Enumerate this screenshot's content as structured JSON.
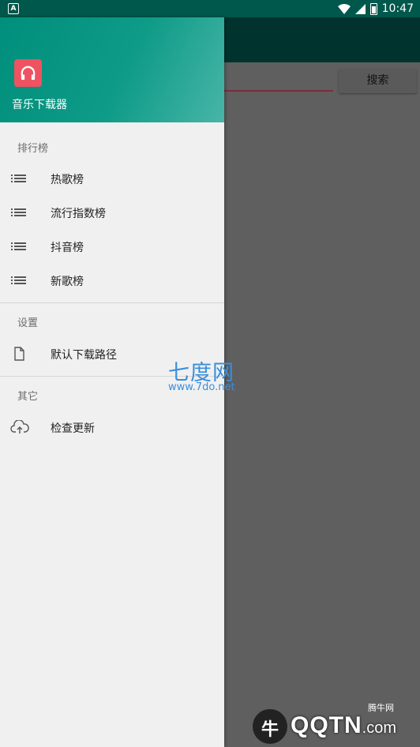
{
  "status_bar": {
    "time": "10:47",
    "notification_icon": "A"
  },
  "background": {
    "search_button": "搜索"
  },
  "drawer": {
    "app_name": "音乐下载器",
    "sections": [
      {
        "title": "排行榜",
        "items": [
          "热歌榜",
          "流行指数榜",
          "抖音榜",
          "新歌榜"
        ]
      },
      {
        "title": "设置",
        "items": [
          "默认下载路径"
        ]
      },
      {
        "title": "其它",
        "items": [
          "检查更新"
        ]
      }
    ]
  },
  "watermark": {
    "line1": "七度网",
    "line2": "www.7do.net"
  },
  "brand": {
    "circle_char": "牛",
    "text": "QQTN",
    "suffix": ".com",
    "small": "腾牛网"
  },
  "colors": {
    "accent": "#009688",
    "logo": "#ef5260",
    "status_bar": "#00574b"
  }
}
